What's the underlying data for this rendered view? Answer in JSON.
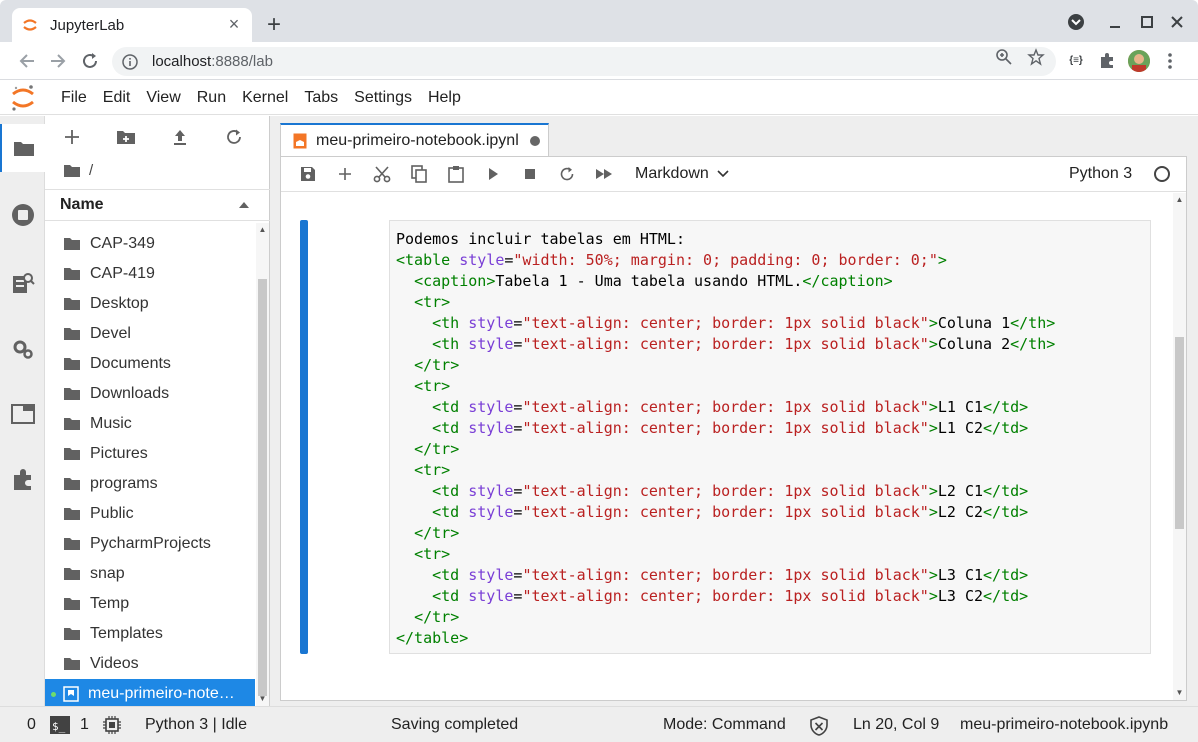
{
  "browser": {
    "tab_title": "JupyterLab",
    "url_host": "localhost",
    "url_rest": ":8888/lab",
    "ext_badge": "{≡}"
  },
  "menu": [
    "File",
    "Edit",
    "View",
    "Run",
    "Kernel",
    "Tabs",
    "Settings",
    "Help"
  ],
  "filebrowser": {
    "path": "/",
    "column_name": "Name",
    "items": [
      "CAP-349",
      "CAP-419",
      "Desktop",
      "Devel",
      "Documents",
      "Downloads",
      "Music",
      "Pictures",
      "programs",
      "Public",
      "PycharmProjects",
      "snap",
      "Temp",
      "Templates",
      "Videos"
    ],
    "selected_notebook": "meu-primeiro-notebook.ipynb"
  },
  "notebook": {
    "tab_title": "meu-primeiro-notebook.ipynl",
    "cell_type": "Markdown",
    "kernel": "Python 3",
    "cell_source_plain": "Podemos incluir tabelas em HTML:",
    "cell_source_lines": [
      "<table style=\"width: 50%; margin: 0; padding: 0; border: 0;\">",
      "  <caption>Tabela 1 - Uma tabela usando HTML.</caption>",
      "  <tr>",
      "    <th style=\"text-align: center; border: 1px solid black\">Coluna 1</th>",
      "    <th style=\"text-align: center; border: 1px solid black\">Coluna 2</th>",
      "  </tr>",
      "  <tr>",
      "    <td style=\"text-align: center; border: 1px solid black\">L1 C1</td>",
      "    <td style=\"text-align: center; border: 1px solid black\">L1 C2</td>",
      "  </tr>",
      "  <tr>",
      "    <td style=\"text-align: center; border: 1px solid black\">L2 C1</td>",
      "    <td style=\"text-align: center; border: 1px solid black\">L2 C2</td>",
      "  </tr>",
      "  <tr>",
      "    <td style=\"text-align: center; border: 1px solid black\">L3 C1</td>",
      "    <td style=\"text-align: center; border: 1px solid black\">L3 C2</td>",
      "  </tr>",
      "</table>"
    ]
  },
  "statusbar": {
    "terminals": "0",
    "kernels": "1",
    "kernel_status": "Python 3 | Idle",
    "message": "Saving completed",
    "mode": "Mode: Command",
    "cursor": "Ln 20, Col 9",
    "filename": "meu-primeiro-notebook.ipynb"
  },
  "colors": {
    "accent": "#1976d2",
    "selected_row": "#1e88e5",
    "jupyter_orange": "#f37626",
    "tag_green": "#008000",
    "string_red": "#ba2121",
    "attr_purple": "#7a3fd6"
  }
}
